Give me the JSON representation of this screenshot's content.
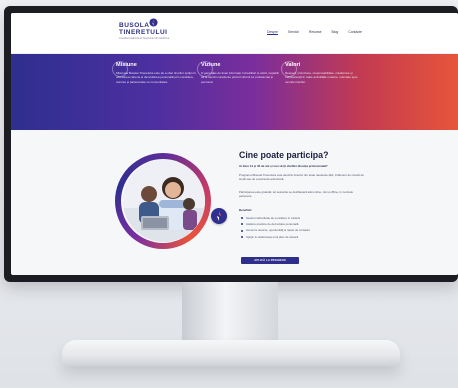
{
  "header": {
    "logo_title_line1": "BUSOLA",
    "logo_title_line2": "TINERETULUI",
    "logo_subtitle": "Consiliul Național al Tineretului din Moldova",
    "logo_icon": "compass-icon",
    "nav": [
      "Despre",
      "Servicii",
      "Resurse",
      "Blog",
      "Contacte"
    ],
    "active_nav": "Despre"
  },
  "band": {
    "columns": [
      {
        "title": "Misiune",
        "icon": "target-icon",
        "text": "Misiunea Busolei Tineretului este de a oferi tinerilor sprijin în orientarea carierei și dezvoltarea personală prin consiliere, resurse și parteneriate cu comunitatea."
      },
      {
        "title": "Viziune",
        "icon": "eye-icon",
        "text": "O generație de tineri informați, încrezători și activi, capabili să ia decizii conștiente privind viitorul lor profesional și personal."
      },
      {
        "title": "Valori",
        "icon": "heart-icon",
        "text": "Respect, incluziune, responsabilitate, colaborare și transparență în toate activitățile noastre, orientate spre nevoile tinerilor."
      }
    ],
    "colors": {
      "start": "#2e2f8f",
      "mid": "#7c2e9b",
      "end": "#e7553a"
    }
  },
  "section": {
    "title": "Cine poate participa?",
    "intro": "Ai între 14 și 35 de ani și vrei să îți clarifici direcția profesională?",
    "p1": "Programul Busola Tineretului este deschis tinerilor din toate raioanele țării, indiferent de nivelul de studii sau de experiența anterioară.",
    "p2": "Participarea este gratuită, iar sesiunile se desfășoară atât online, cât și offline, în centrele partenere.",
    "benefits_label": "Beneficii:",
    "bullets": [
      "Sesiuni individuale de consiliere în carieră",
      "Ateliere practice de dezvoltare personală",
      "Acces la resurse, oportunități și rețele de contacte",
      "Sprijin în elaborarea unui plan de carieră"
    ],
    "cta_label": "APLICĂ LA PROGRAM"
  }
}
